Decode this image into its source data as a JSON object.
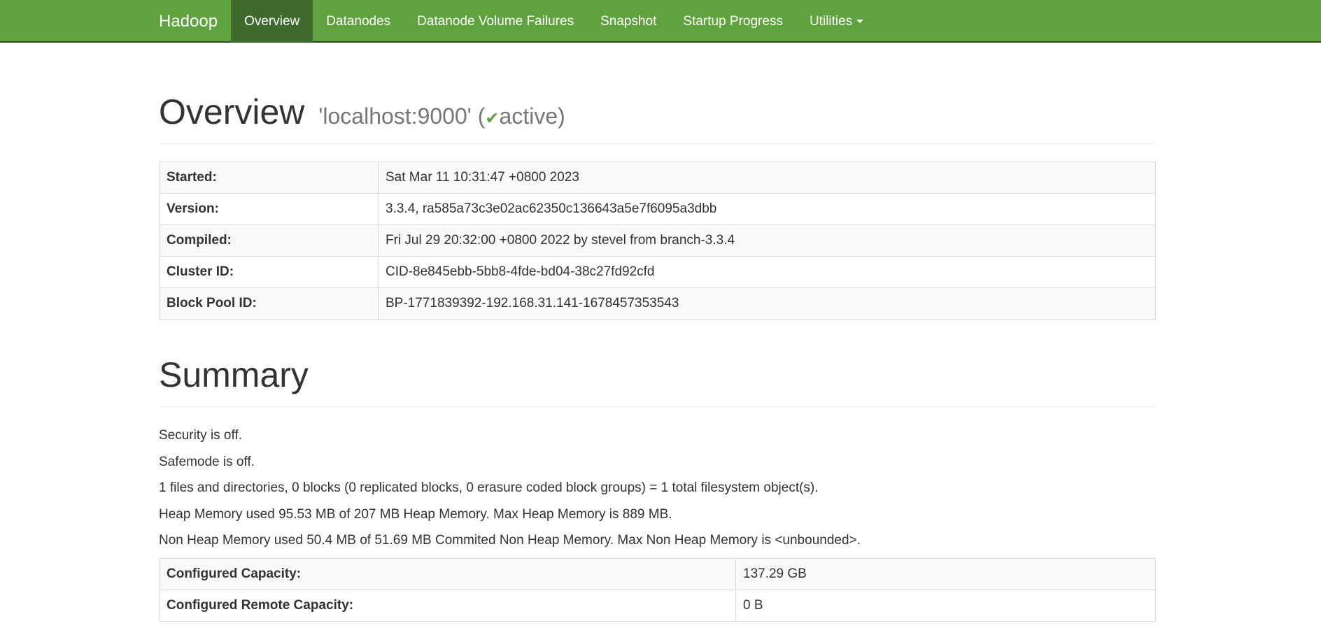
{
  "navbar": {
    "brand": "Hadoop",
    "items": [
      {
        "label": "Overview",
        "active": true
      },
      {
        "label": "Datanodes"
      },
      {
        "label": "Datanode Volume Failures"
      },
      {
        "label": "Snapshot"
      },
      {
        "label": "Startup Progress"
      },
      {
        "label": "Utilities"
      }
    ],
    "bg_color": "#5fa33e",
    "active_color": "#3f6a2d"
  },
  "overview": {
    "title": "Overview",
    "host": "'localhost:9000' (",
    "state": "active",
    "host_close": ")",
    "check_icon": "check-icon",
    "rows": [
      {
        "label": "Started:",
        "value": "Sat Mar 11 10:31:47 +0800 2023"
      },
      {
        "label": "Version:",
        "value": "3.3.4, ra585a73c3e02ac62350c136643a5e7f6095a3dbb"
      },
      {
        "label": "Compiled:",
        "value": "Fri Jul 29 20:32:00 +0800 2022 by stevel from branch-3.3.4"
      },
      {
        "label": "Cluster ID:",
        "value": "CID-8e845ebb-5bb8-4fde-bd04-38c27fd92cfd"
      },
      {
        "label": "Block Pool ID:",
        "value": "BP-1771839392-192.168.31.141-1678457353543"
      }
    ]
  },
  "summary": {
    "title": "Summary",
    "lines": [
      "Security is off.",
      "Safemode is off.",
      "1 files and directories, 0 blocks (0 replicated blocks, 0 erasure coded block groups) = 1 total filesystem object(s).",
      "Heap Memory used 95.53 MB of 207 MB Heap Memory. Max Heap Memory is 889 MB.",
      "Non Heap Memory used 50.4 MB of 51.69 MB Commited Non Heap Memory. Max Non Heap Memory is <unbounded>."
    ],
    "rows": [
      {
        "label": "Configured Capacity:",
        "value": "137.29 GB"
      },
      {
        "label": "Configured Remote Capacity:",
        "value": "0 B"
      }
    ]
  }
}
